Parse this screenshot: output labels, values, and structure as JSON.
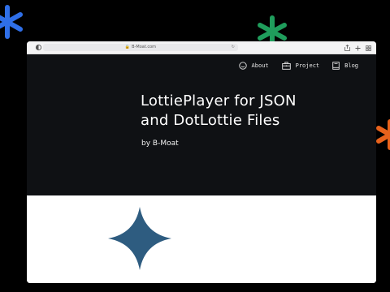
{
  "colors": {
    "background": "#000000",
    "asterisk_blue": "#2f6fe8",
    "asterisk_green": "#1f9d5c",
    "asterisk_orange": "#e8621c",
    "hero_bg": "#0f1114",
    "sparkle": "#2e5c80"
  },
  "browser": {
    "url": "B-Moat.com"
  },
  "nav": {
    "items": [
      {
        "label": "About",
        "icon": "smiley-icon"
      },
      {
        "label": "Project",
        "icon": "briefcase-icon"
      },
      {
        "label": "Blog",
        "icon": "book-icon"
      }
    ]
  },
  "hero": {
    "title_line1": "LottiePlayer for JSON",
    "title_line2": "and DotLottie Files",
    "author": "by B-Moat"
  }
}
